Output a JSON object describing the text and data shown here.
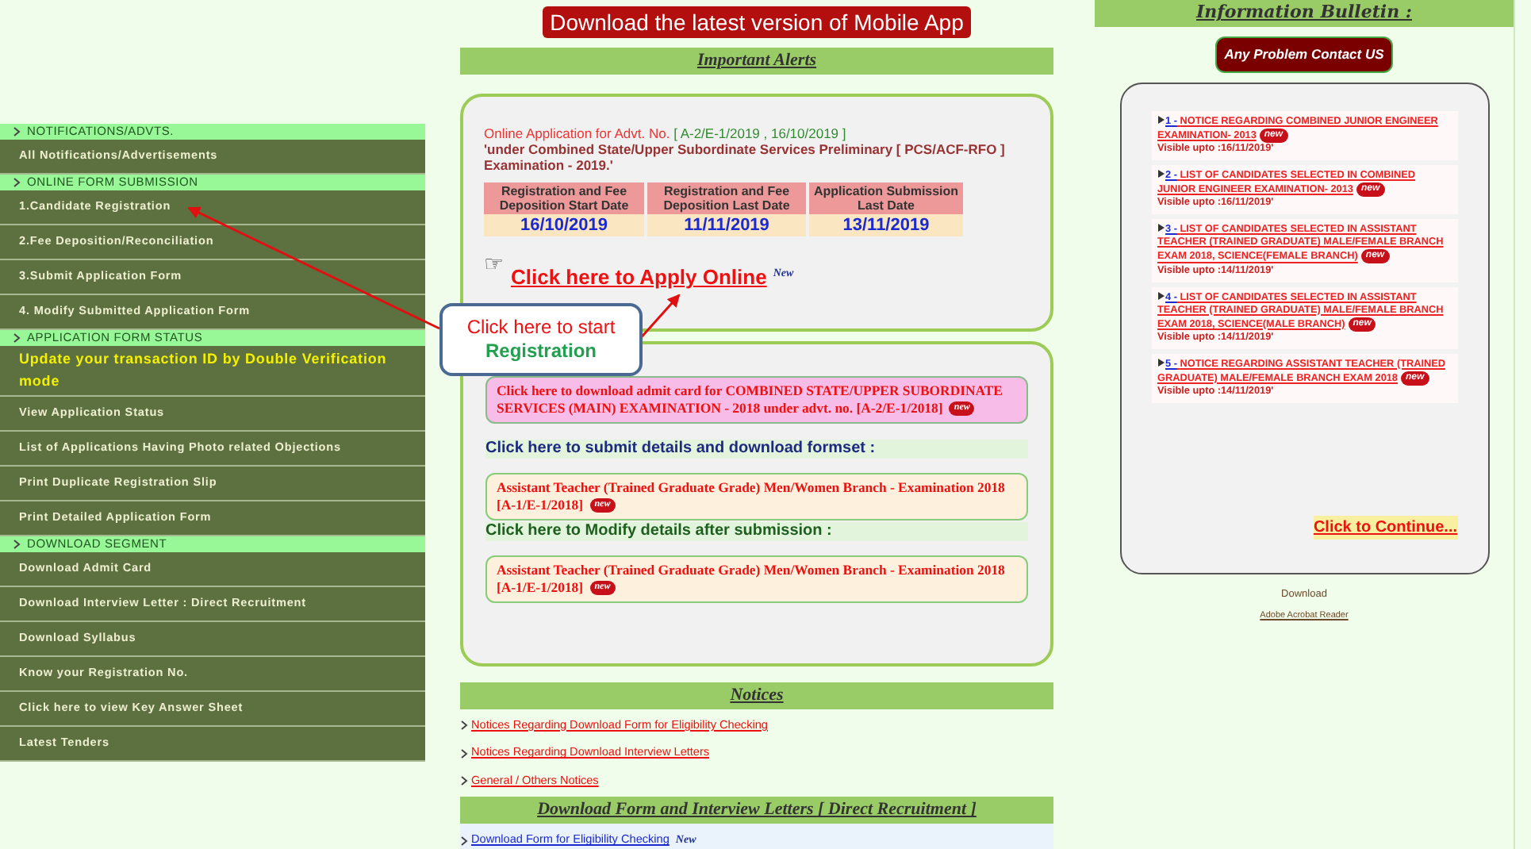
{
  "mobile_app_button": "Download the latest version of Mobile App",
  "sidebar": [
    {
      "title": "NOTIFICATIONS/ADVTS.",
      "items": [
        {
          "label": "All Notifications/Advertisements",
          "kind": "link"
        }
      ]
    },
    {
      "title": "ONLINE FORM SUBMISSION",
      "items": [
        {
          "label": "1.Candidate Registration",
          "kind": "link"
        },
        {
          "label": "2.Fee Deposition/Reconciliation",
          "kind": "link"
        },
        {
          "label": "3.Submit Application Form",
          "kind": "link"
        },
        {
          "label": "4. Modify Submitted Application Form",
          "kind": "link"
        }
      ]
    },
    {
      "title": "APPLICATION FORM STATUS",
      "items": [
        {
          "label": "Update your transaction ID by Double Verification mode",
          "kind": "highlight"
        },
        {
          "label": "View Application Status",
          "kind": "link"
        },
        {
          "label": "List of Applications Having Photo related Objections",
          "kind": "link"
        },
        {
          "label": "Print Duplicate Registration Slip",
          "kind": "link"
        },
        {
          "label": "Print Detailed Application Form",
          "kind": "link"
        }
      ]
    },
    {
      "title": "DOWNLOAD SEGMENT",
      "items": [
        {
          "label": "Download Admit Card",
          "kind": "link"
        },
        {
          "label": "Download Interview Letter : Direct Recruitment",
          "kind": "link"
        },
        {
          "label": "Download Syllabus",
          "kind": "link"
        },
        {
          "label": "Know your Registration No.",
          "kind": "link"
        },
        {
          "label": "Click here to view Key Answer Sheet",
          "kind": "link"
        },
        {
          "label": "Latest Tenders",
          "kind": "link"
        }
      ]
    }
  ],
  "important_alerts": {
    "title": "Important Alerts",
    "advt_label": "Online Application for Advt. No.",
    "advt_number": "[ A-2/E-1/2019 , 16/10/2019 ]",
    "advt_description": "'under Combined State/Upper Subordinate Services Preliminary [ PCS/ACF-RFO ] Examination - 2019.'",
    "table": {
      "columns": [
        "Registration and Fee Deposition Start Date",
        "Registration and Fee Deposition Last Date",
        "Application Submission Last Date"
      ],
      "values": [
        "16/10/2019",
        "11/11/2019",
        "13/11/2019"
      ]
    },
    "pointer": "☞",
    "apply_link": "Click here to Apply Online",
    "apply_badge": "New"
  },
  "forms_box": {
    "admit_card_notice": "Click here to download admit card for COMBINED STATE/UPPER SUBORDINATE SERVICES (MAIN) EXAMINATION - 2018 under advt. no. [A-2/E-1/2018]",
    "admit_badge": "new",
    "sections": [
      {
        "heading": "Click here to submit details and download formset :",
        "link": "Assistant Teacher (Trained Graduate Grade) Men/Women Branch - Examination 2018 [A-1/E-1/2018]",
        "badge": "new"
      },
      {
        "heading": "Click here to Modify details after submission :",
        "link": "Assistant Teacher (Trained Graduate Grade) Men/Women Branch - Examination 2018 [A-1/E-1/2018]",
        "badge": "new"
      }
    ]
  },
  "callout": {
    "line1": "Click here to start",
    "line2": "Registration"
  },
  "notices": {
    "title": "Notices",
    "links": [
      "Notices Regarding Download Form for Eligibility Checking",
      "Notices Regarding Download Interview Letters",
      "General / Others Notices"
    ]
  },
  "download_forms": {
    "title": "Download Form and Interview Letters [ Direct Recruitment ]",
    "links": [
      {
        "label": "Download Form for Eligibility Checking",
        "badge": "New"
      }
    ]
  },
  "bulletin": {
    "title": "Information Bulletin :",
    "contact_button": "Any Problem Contact US",
    "items": [
      {
        "number": "1 -",
        "title": "NOTICE REGARDING COMBINED JUNIOR ENGINEER EXAMINATION- 2013",
        "badge": "new",
        "visible": "Visible upto :16/11/2019'"
      },
      {
        "number": "2 -",
        "title": "LIST OF CANDIDATES SELECTED IN COMBINED JUNIOR ENGINEER EXAMINATION- 2013",
        "badge": "new",
        "visible": "Visible upto :16/11/2019'"
      },
      {
        "number": "3 -",
        "title": "LIST OF CANDIDATES SELECTED IN ASSISTANT TEACHER (TRAINED GRADUATE) MALE/FEMALE BRANCH EXAM 2018, SCIENCE(FEMALE BRANCH)",
        "badge": "new",
        "visible": "Visible upto :14/11/2019'"
      },
      {
        "number": "4 -",
        "title": "LIST OF CANDIDATES SELECTED IN ASSISTANT TEACHER (TRAINED GRADUATE) MALE/FEMALE BRANCH EXAM 2018, SCIENCE(MALE BRANCH)",
        "badge": "new",
        "visible": "Visible upto :14/11/2019'"
      },
      {
        "number": "5 -",
        "title": "NOTICE REGARDING ASSISTANT TEACHER (TRAINED GRADUATE) MALE/FEMALE BRANCH EXAM 2018",
        "badge": "new",
        "visible": "Visible upto :14/11/2019'"
      }
    ],
    "continue_link": "Click to Continue...",
    "download_label": "Download",
    "acrobat_link": "Adobe Acrobat Reader"
  }
}
